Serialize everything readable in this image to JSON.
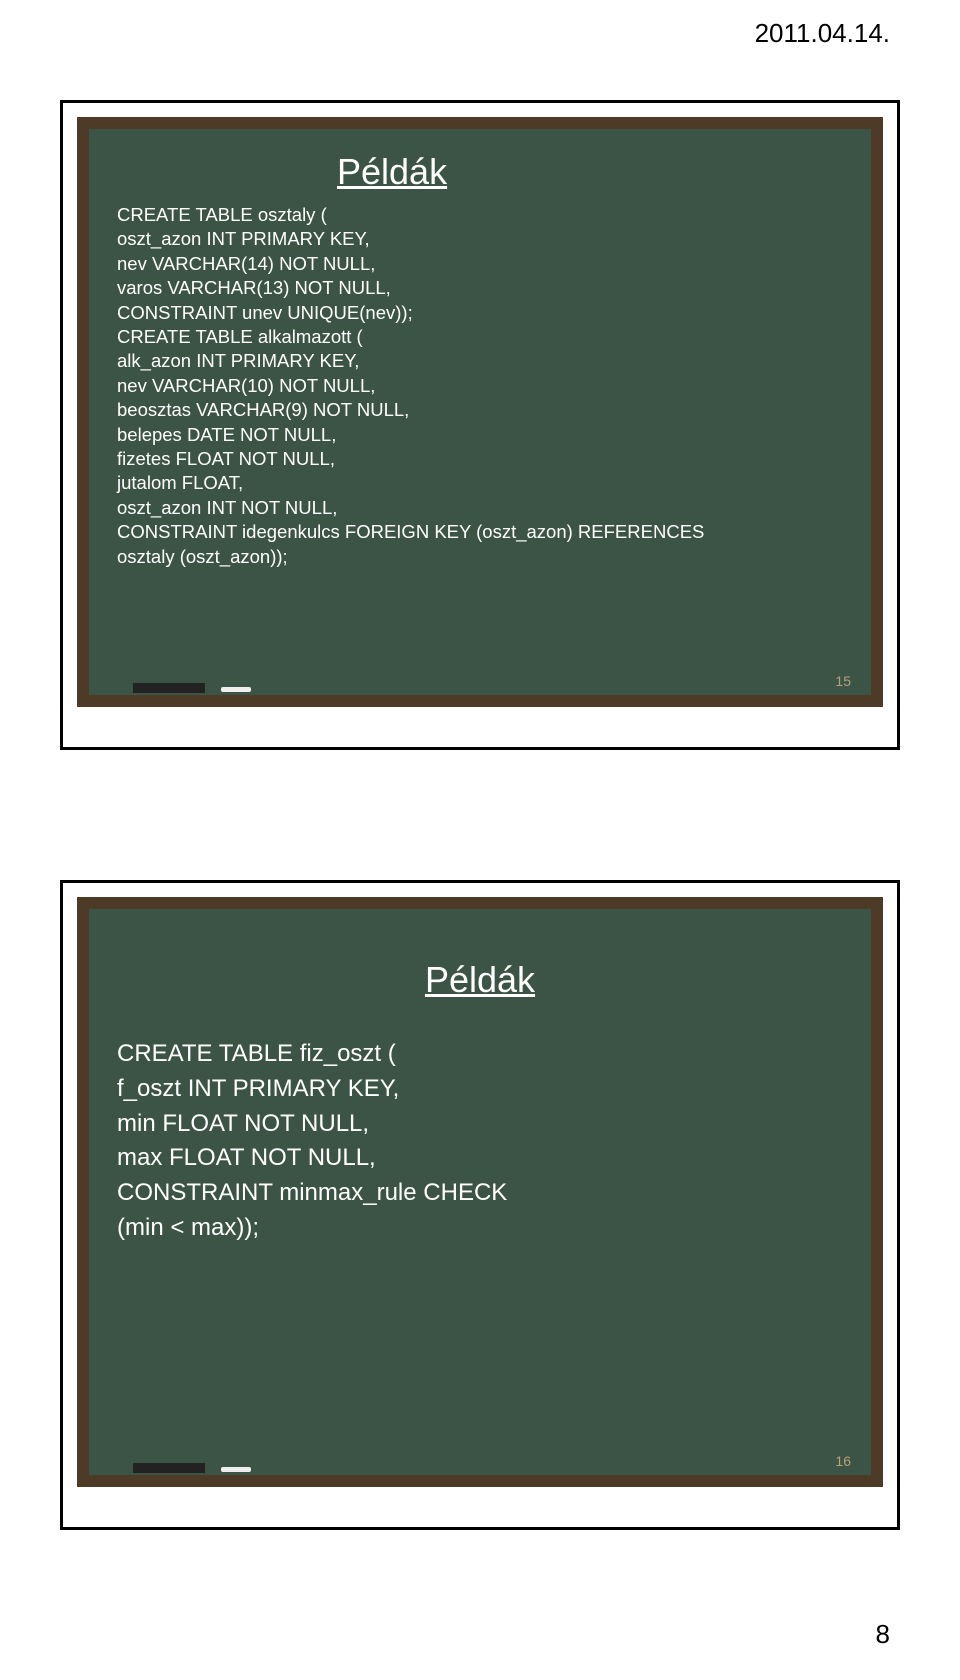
{
  "date": "2011.04.14.",
  "page_number": "8",
  "slide1": {
    "title": "Példák",
    "number": "15",
    "lines": [
      "CREATE TABLE osztaly (",
      "oszt_azon INT PRIMARY KEY,",
      "nev VARCHAR(14) NOT NULL,",
      "varos VARCHAR(13) NOT NULL,",
      "CONSTRAINT unev UNIQUE(nev));",
      "",
      "CREATE TABLE alkalmazott (",
      "alk_azon INT PRIMARY KEY,",
      "nev VARCHAR(10) NOT NULL,",
      "beosztas VARCHAR(9) NOT NULL,",
      "belepes DATE NOT NULL,",
      "fizetes FLOAT NOT NULL,",
      "jutalom FLOAT,",
      "oszt_azon INT NOT NULL,",
      "CONSTRAINT idegenkulcs FOREIGN KEY (oszt_azon) REFERENCES",
      "osztaly (oszt_azon));"
    ]
  },
  "slide2": {
    "title": "Példák",
    "number": "16",
    "lines": [
      "CREATE TABLE fiz_oszt (",
      "f_oszt INT PRIMARY KEY,",
      "min FLOAT NOT NULL,",
      "max FLOAT NOT NULL,",
      "CONSTRAINT minmax_rule CHECK",
      "(min < max));"
    ]
  }
}
